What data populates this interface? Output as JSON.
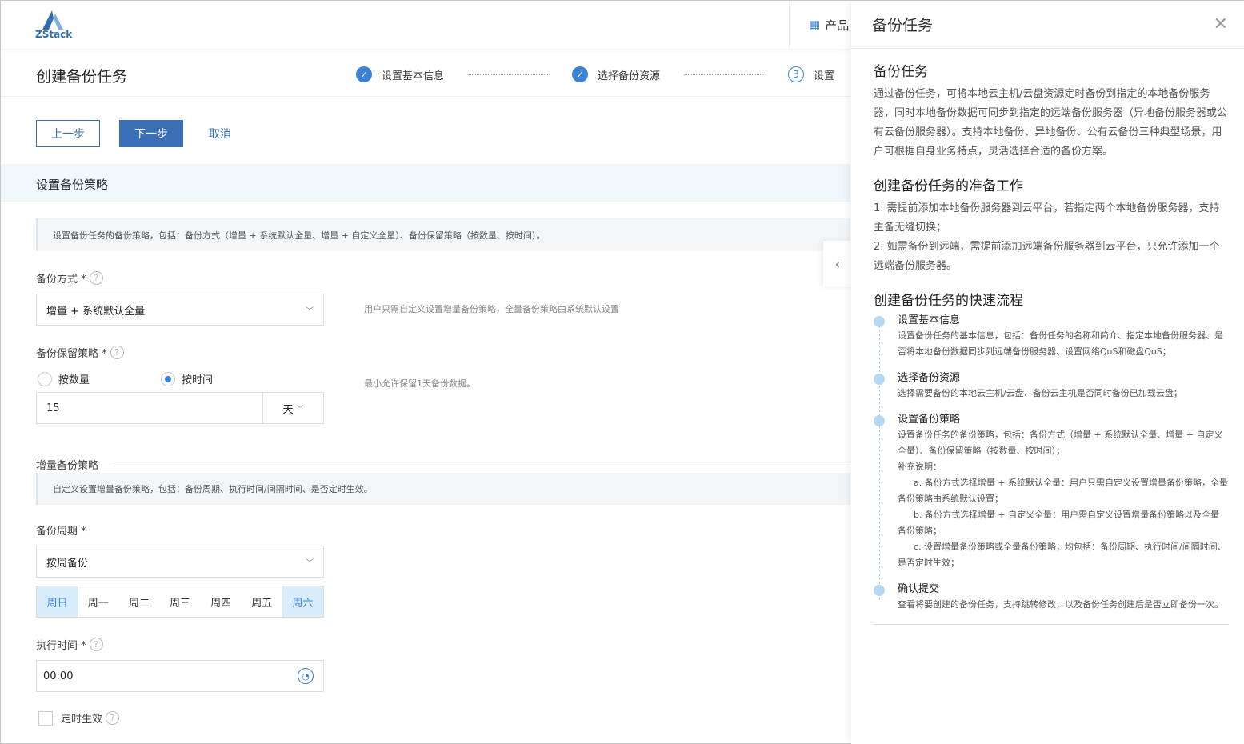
{
  "header": {
    "logo": "ZStack",
    "products": "产品"
  },
  "page": {
    "title": "创建备份任务",
    "steps": [
      {
        "label": "设置基本信息",
        "state": "done"
      },
      {
        "label": "选择备份资源",
        "state": "done"
      },
      {
        "number": "3",
        "label": "设置"
      }
    ]
  },
  "actions": {
    "prev": "上一步",
    "next": "下一步",
    "cancel": "取消"
  },
  "section": {
    "title": "设置备份策略",
    "info": "设置备份任务的备份策略，包括：备份方式（增量 + 系统默认全量、增量 + 自定义全量）、备份保留策略（按数量、按时间）。"
  },
  "form": {
    "mode": {
      "label": "备份方式 *",
      "value": "增量 + 系统默认全量",
      "hint": "用户只需自定义设置增量备份策略，全量备份策略由系统默认设置"
    },
    "retention": {
      "label": "备份保留策略 *",
      "options": [
        "按数量",
        "按时间"
      ],
      "selected": "按时间",
      "value": "15",
      "unit": "天",
      "hint": "最小允许保留1天备份数据。"
    },
    "incremental": {
      "title": "增量备份策略",
      "info": "自定义设置增量备份策略，包括：备份周期、执行时间/间隔时间、是否定时生效。"
    },
    "cycle": {
      "label": "备份周期 *",
      "value": "按周备份",
      "days": [
        "周日",
        "周一",
        "周二",
        "周三",
        "周四",
        "周五",
        "周六"
      ],
      "selected_days": [
        "周日",
        "周六"
      ]
    },
    "time": {
      "label": "执行时间 *",
      "value": "00:00"
    },
    "scheduled": {
      "label": "定时生效",
      "checked": false
    }
  },
  "panel": {
    "title": "备份任务",
    "h1": "备份任务",
    "p1": "通过备份任务，可将本地云主机/云盘资源定时备份到指定的本地备份服务器，同时本地备份数据可同步到指定的远端备份服务器（异地备份服务器或公有云备份服务器）。支持本地备份、异地备份、公有云备份三种典型场景，用户可根据自身业务特点，灵活选择合适的备份方案。",
    "h2": "创建备份任务的准备工作",
    "prep": [
      "1. 需提前添加本地备份服务器到云平台，若指定两个本地备份服务器，支持主备无缝切换；",
      "2. 如需备份到远端，需提前添加远端备份服务器到云平台，只允许添加一个远端备份服务器。"
    ],
    "h3": "创建备份任务的快速流程",
    "flow": [
      {
        "title": "设置基本信息",
        "desc": [
          "设置备份任务的基本信息，包括：备份任务的名称和简介、指定本地备份服务器、是否将本地备份数据同步到远端备份服务器、设置网络QoS和磁盘QoS；"
        ]
      },
      {
        "title": "选择备份资源",
        "desc": [
          "选择需要备份的本地云主机/云盘、备份云主机是否同时备份已加载云盘；"
        ]
      },
      {
        "title": "设置备份策略",
        "desc": [
          "设置备份任务的备份策略，包括：备份方式（增量 + 系统默认全量、增量 + 自定义全量）、备份保留策略（按数量、按时间）；",
          "补充说明：",
          "a. 备份方式选择增量 + 系统默认全量：用户只需自定义设置增量备份策略，全量备份策略由系统默认设置；",
          "b. 备份方式选择增量 + 自定义全量：用户需自定义设置增量备份策略以及全量备份策略；",
          "c. 设置增量备份策略或全量备份策略，均包括：备份周期、执行时间/间隔时间、是否定时生效；"
        ]
      },
      {
        "title": "确认提交",
        "desc": [
          "查看将要创建的备份任务，支持跳转修改，以及备份任务创建后是否立即备份一次。"
        ]
      }
    ]
  },
  "colors": {
    "accent": "#3b6fb5",
    "step": "#3b82d6",
    "band": "#eff6fc"
  }
}
